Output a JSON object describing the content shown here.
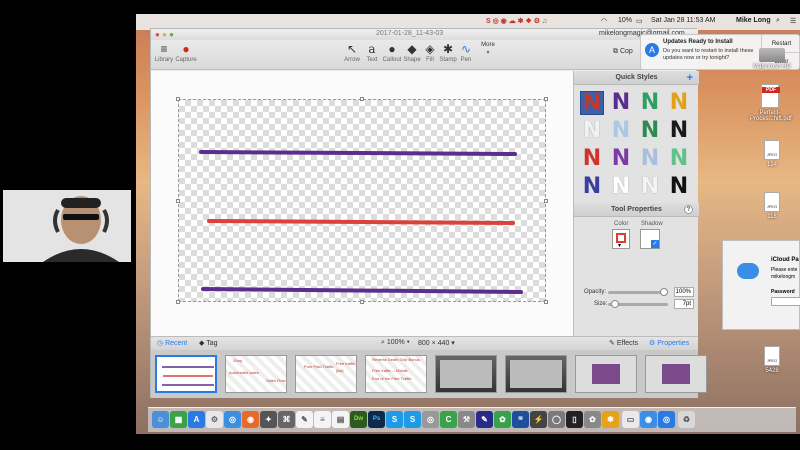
{
  "menubar": {
    "battery": "10%",
    "datetime": "Sat Jan 28  11:53 AM",
    "user": "Mike Long"
  },
  "window": {
    "title": "2017-01-28_11-43-03",
    "account": "mikelongmagic@gmail.com",
    "left_tools": [
      {
        "label": "Library",
        "icon": "library-icon"
      },
      {
        "label": "Capture",
        "icon": "record-icon"
      }
    ],
    "tools": [
      {
        "label": "Arrow",
        "icon": "arrow-icon"
      },
      {
        "label": "Text",
        "icon": "text-icon"
      },
      {
        "label": "Callout",
        "icon": "callout-icon"
      },
      {
        "label": "Shape",
        "icon": "shape-icon"
      },
      {
        "label": "Fill",
        "icon": "fill-icon"
      },
      {
        "label": "Stamp",
        "icon": "stamp-icon"
      },
      {
        "label": "Pen",
        "icon": "pen-icon"
      }
    ],
    "more_label": "More",
    "copy_label": "Cop"
  },
  "panel": {
    "quick_styles_title": "Quick Styles",
    "add_label": "+",
    "tool_properties_title": "Tool Properties",
    "help_label": "?",
    "color_label": "Color",
    "shadow_label": "Shadow",
    "opacity_label": "Opacity:",
    "opacity_value": "100%",
    "opacity_fraction": 1.0,
    "size_label": "Size:",
    "size_value": "7pt",
    "swatch_colors": [
      "#c0392b",
      "#5b2d8e",
      "#2e9e63",
      "#e0a21a",
      "#f2f2f2",
      "#a9c7e6",
      "#2f8a52",
      "#1a1a1a",
      "#d0322d",
      "#7b3ba8",
      "#a8c0de",
      "#5fc28a",
      "#3a3f9e",
      "#ffffff",
      "#f4f4f4",
      "#111111"
    ]
  },
  "status": {
    "recent_label": "Recent",
    "tag_label": "Tag",
    "zoom": "100%",
    "dimensions": "800 × 440",
    "effects_label": "Effects",
    "properties_label": "Properties"
  },
  "tray": {
    "thumb_texts": [
      [
        "Shop",
        "Automated sales",
        "Sales Flow"
      ],
      [
        "Pure Paid Traffic",
        "Free traffic",
        "(list)"
      ],
      [
        "Reverse Death Grip Bonus",
        "Free traffic -- Mobile",
        "End of the Free Traffic"
      ]
    ]
  },
  "notification": {
    "title": "Updates Ready to Install",
    "body": "Do you want to restart to install these updates now or try tonight?",
    "restart_label": "Restart",
    "later_label": "Later"
  },
  "icloud": {
    "title": "iCloud Pa",
    "body1": "Please ente",
    "body2": "mikelongm",
    "password_label": "Password"
  },
  "desktop_icons": [
    {
      "label": "Macintosh HD"
    },
    {
      "label": "Perfect-Proces...hift.pdf",
      "badge": "PDF"
    },
    {
      "label": "124",
      "badge": "JPEG"
    },
    {
      "label": "118",
      "badge": "JPEG"
    },
    {
      "label": "5428",
      "badge": "JPEG"
    }
  ],
  "canvas_lines": [
    {
      "color": "#5b2d8e"
    },
    {
      "color": "#d9433b"
    },
    {
      "color": "#5b2d8e"
    }
  ],
  "colors": {
    "accent": "#2a7ae4",
    "selected_color": "#e03c31"
  }
}
